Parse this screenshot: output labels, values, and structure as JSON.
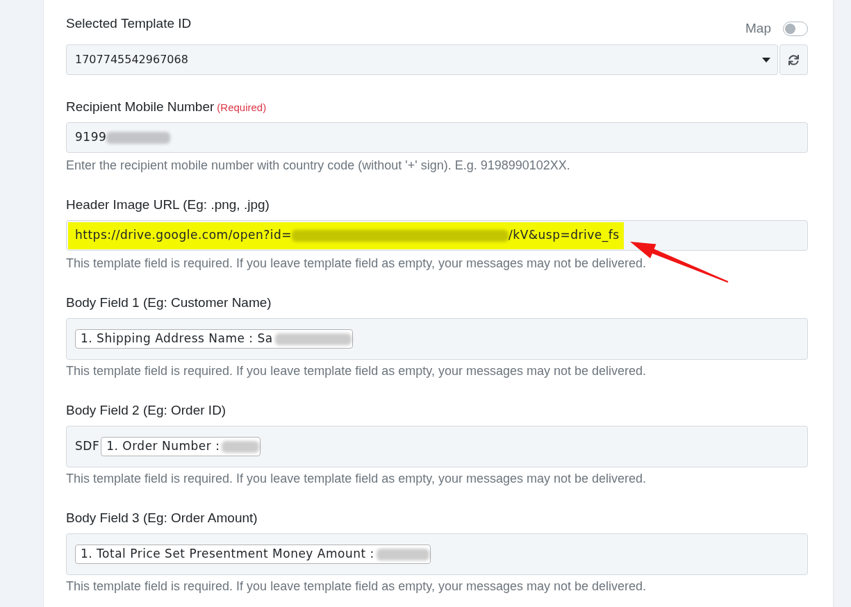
{
  "template_select": {
    "label": "Selected Template ID",
    "value": "1707745542967068",
    "map_toggle": {
      "label": "Map",
      "on": false
    }
  },
  "fields": [
    {
      "kind": "input",
      "label": "Recipient Mobile Number",
      "required_note": "(Required)",
      "highlighted": false,
      "value": [
        {
          "kind": "text",
          "text": "9199"
        },
        {
          "kind": "blur"
        }
      ],
      "help": "Enter the recipient mobile number with country code (without '+' sign). E.g. 9198990102XX."
    },
    {
      "kind": "input",
      "label": "Header Image URL (Eg: .png, .jpg)",
      "highlighted": true,
      "annotation": {
        "kind": "arrow"
      },
      "value": [
        {
          "kind": "text",
          "text": "https://drive.google.com/open?id="
        },
        {
          "kind": "blur"
        },
        {
          "kind": "text",
          "text": "/kV&usp=drive_fs"
        }
      ],
      "help": "This template field is required. If you leave template field as empty, your messages may not be delivered."
    },
    {
      "kind": "tags",
      "label": "Body Field 1 (Eg: Customer Name)",
      "value": [
        {
          "kind": "tag",
          "parts": [
            {
              "kind": "text",
              "text": "1. Shipping Address Name : Sa"
            },
            {
              "kind": "blur"
            }
          ]
        }
      ],
      "help": "This template field is required. If you leave template field as empty, your messages may not be delivered."
    },
    {
      "kind": "tags",
      "label": "Body Field 2 (Eg: Order ID)",
      "value": [
        {
          "kind": "text",
          "text": "SDF"
        },
        {
          "kind": "tag",
          "parts": [
            {
              "kind": "text",
              "text": "1. Order Number :"
            },
            {
              "kind": "blur"
            }
          ]
        }
      ],
      "help": "This template field is required. If you leave template field as empty, your messages may not be delivered."
    },
    {
      "kind": "tags",
      "label": "Body Field 3 (Eg: Order Amount)",
      "value": [
        {
          "kind": "tag",
          "parts": [
            {
              "kind": "text",
              "text": "1. Total Price Set Presentment Money Amount :"
            },
            {
              "kind": "blur"
            }
          ]
        }
      ],
      "help": "This template field is required. If you leave template field as empty, your messages may not be delivered."
    }
  ]
}
